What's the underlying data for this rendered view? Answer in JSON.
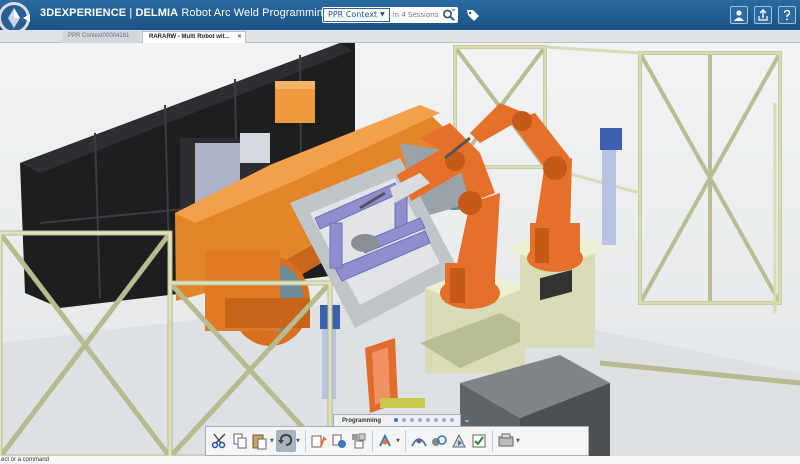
{
  "title_bar": {
    "brand": "3DEXPERIENCE",
    "separator": " | ",
    "product": "DELMIA",
    "app_name": " Robot Arc Weld Programming",
    "context_select": "PPR Context",
    "search_placeholder": "in 4 Sessions",
    "icons": [
      "compass-icon",
      "search-icon",
      "tag-icon",
      "user-icon",
      "share-icon",
      "help-icon"
    ]
  },
  "tabs": [
    {
      "label": "PPR Context00004281",
      "active": false
    },
    {
      "label": "RARARW - Multi Robot wit...",
      "active": true,
      "close": "✕"
    }
  ],
  "action_bar": {
    "section_label": "Programming",
    "page_dots": 8,
    "active_dot": 0,
    "expand_glyph": "⌄",
    "groups": [
      [
        "cut-icon",
        "copy-icon",
        "paste-icon",
        "undo-icon"
      ],
      [
        "robot-program-icon",
        "teach-icon",
        "device-icon"
      ],
      [
        "seam-icon"
      ],
      [
        "trajectory-icon",
        "weld-path-icon",
        "simulate-icon",
        "check-reach-icon"
      ],
      [
        "settings-icon"
      ]
    ]
  },
  "status_bar": {
    "text": "ect or a command"
  },
  "colors": {
    "title_bar": "#1f5a90",
    "robot": "#e0702a",
    "positioner": "#e38a2e",
    "frame": "#d8dcb2",
    "fixture": "#8f8fd0",
    "wall": "#222222",
    "controller": "#3c5fb0"
  }
}
